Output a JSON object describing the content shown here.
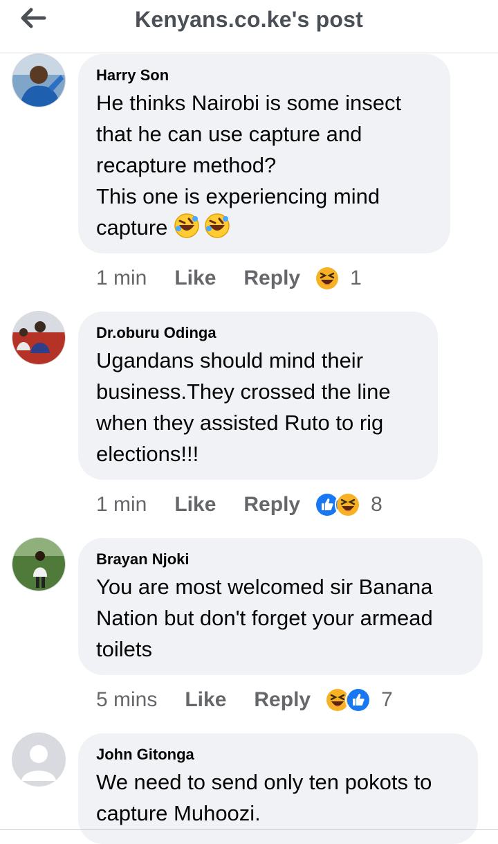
{
  "header": {
    "title": "Kenyans.co.ke's post"
  },
  "icons": {
    "back": "arrow-left-icon",
    "haha": "haha-reaction-icon",
    "like": "like-reaction-icon",
    "emoji": "rolling-laughing-emoji"
  },
  "colors": {
    "bubble": "#f0f2f5",
    "meta": "#65676b",
    "like_blue": "#1877f2",
    "haha_yellow": "#f7b125"
  },
  "comments": [
    {
      "author": "Harry Son",
      "text": "He thinks Nairobi is some insect that he can use capture and recapture method?\nThis one is experiencing mind capture",
      "time": "1 min",
      "like": "Like",
      "reply": "Reply",
      "reactions": [
        "haha"
      ],
      "count": "1"
    },
    {
      "author": "Dr.oburu Odinga",
      "text": "Ugandans should mind their business.They crossed the line when they assisted Ruto to rig elections!!!",
      "time": "1 min",
      "like": "Like",
      "reply": "Reply",
      "reactions": [
        "like",
        "haha"
      ],
      "count": "8"
    },
    {
      "author": "Brayan Njoki",
      "text": "You are most welcomed sir Banana Nation but don't forget your armead toilets",
      "time": "5 mins",
      "like": "Like",
      "reply": "Reply",
      "reactions": [
        "haha",
        "like"
      ],
      "count": "7"
    },
    {
      "author": "John Gitonga",
      "text": "We need to send only ten pokots to capture Muhoozi.",
      "time": "",
      "like": "",
      "reply": "",
      "reactions": [],
      "count": ""
    }
  ]
}
